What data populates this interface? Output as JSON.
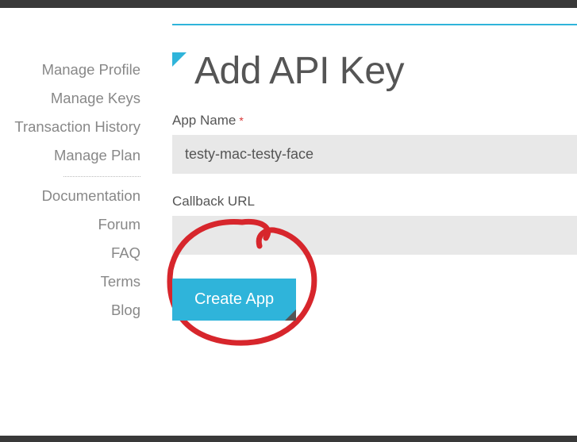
{
  "sidebar": {
    "group1": [
      {
        "label": "Manage Profile",
        "name": "sidebar-item-manage-profile"
      },
      {
        "label": "Manage Keys",
        "name": "sidebar-item-manage-keys"
      },
      {
        "label": "Transaction History",
        "name": "sidebar-item-transaction-history"
      },
      {
        "label": "Manage Plan",
        "name": "sidebar-item-manage-plan"
      }
    ],
    "group2": [
      {
        "label": "Documentation",
        "name": "sidebar-item-documentation"
      },
      {
        "label": "Forum",
        "name": "sidebar-item-forum"
      },
      {
        "label": "FAQ",
        "name": "sidebar-item-faq"
      },
      {
        "label": "Terms",
        "name": "sidebar-item-terms"
      },
      {
        "label": "Blog",
        "name": "sidebar-item-blog"
      }
    ]
  },
  "page": {
    "title": "Add API Key"
  },
  "form": {
    "appName": {
      "label": "App Name",
      "required": "*",
      "value": "testy-mac-testy-face"
    },
    "callbackUrl": {
      "label": "Callback URL",
      "value": ""
    },
    "submit": "Create App"
  }
}
